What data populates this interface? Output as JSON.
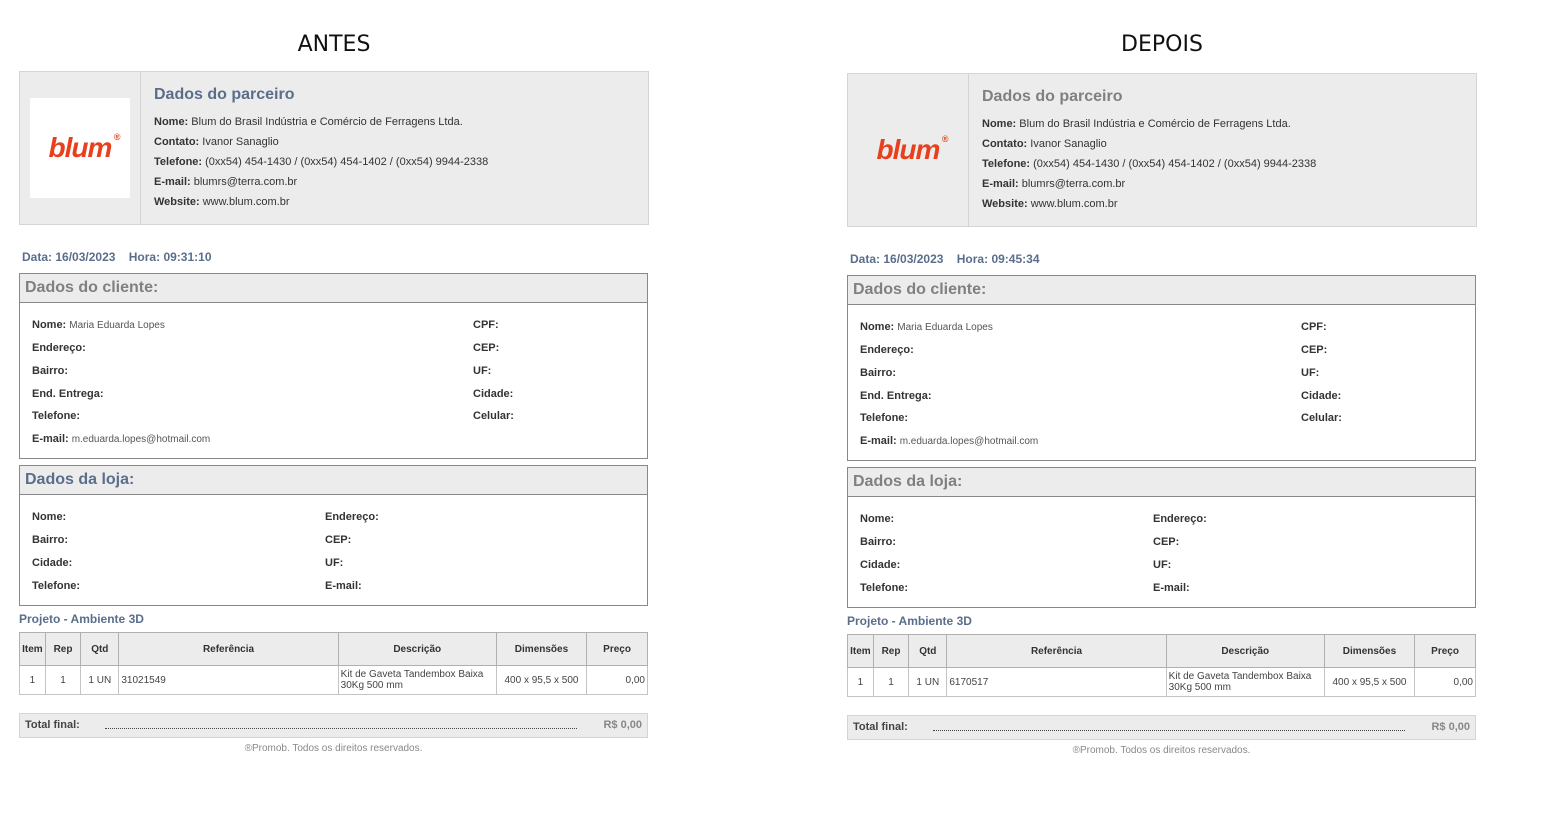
{
  "panels": [
    {
      "heading": "ANTES",
      "partner": {
        "title": "Dados do parceiro",
        "logo_text": "blum",
        "nome_label": "Nome:",
        "nome": "Blum do Brasil Indústria e Comércio de Ferragens Ltda.",
        "contato_label": "Contato:",
        "contato": "Ivanor Sanaglio",
        "telefone_label": "Telefone:",
        "telefone": "(0xx54) 454-1430 / (0xx54) 454-1402 / (0xx54) 9944-2338",
        "email_label": "E-mail:",
        "email": "blumrs@terra.com.br",
        "website_label": "Website:",
        "website": "www.blum.com.br"
      },
      "data_label": "Data:",
      "data": "16/03/2023",
      "hora_label": "Hora:",
      "hora": "09:31:10",
      "cliente": {
        "title": "Dados do cliente:",
        "nome_label": "Nome:",
        "nome": "Maria Eduarda Lopes",
        "cpf_label": "CPF:",
        "endereco_label": "Endereço:",
        "cep_label": "CEP:",
        "bairro_label": "Bairro:",
        "uf_label": "UF:",
        "entrega_label": "End. Entrega:",
        "cidade_label": "Cidade:",
        "telefone_label": "Telefone:",
        "celular_label": "Celular:",
        "email_label": "E-mail:",
        "email": "m.eduarda.lopes@hotmail.com"
      },
      "loja": {
        "title": "Dados da loja:",
        "nome_label": "Nome:",
        "endereco_label": "Endereço:",
        "bairro_label": "Bairro:",
        "cep_label": "CEP:",
        "cidade_label": "Cidade:",
        "uf_label": "UF:",
        "telefone_label": "Telefone:",
        "email_label": "E-mail:"
      },
      "projeto": "Projeto - Ambiente 3D",
      "table": {
        "headers": [
          "Item",
          "Rep",
          "Qtd",
          "Referência",
          "Descrição",
          "Dimensões",
          "Preço"
        ],
        "row": [
          "1",
          "1",
          "1 UN",
          "31021549",
          "Kit de Gaveta Tandembox Baixa 30Kg 500 mm",
          "400 x 95,5 x 500",
          "0,00"
        ]
      },
      "total_label": "Total final:",
      "total": "R$ 0,00",
      "footer": "®Promob. Todos os direitos reservados."
    },
    {
      "heading": "DEPOIS",
      "partner": {
        "title": "Dados do parceiro",
        "logo_text": "blum",
        "nome_label": "Nome:",
        "nome": "Blum do Brasil Indústria e Comércio de Ferragens Ltda.",
        "contato_label": "Contato:",
        "contato": "Ivanor Sanaglio",
        "telefone_label": "Telefone:",
        "telefone": "(0xx54) 454-1430 / (0xx54) 454-1402 / (0xx54) 9944-2338",
        "email_label": "E-mail:",
        "email": "blumrs@terra.com.br",
        "website_label": "Website:",
        "website": "www.blum.com.br"
      },
      "data_label": "Data:",
      "data": "16/03/2023",
      "hora_label": "Hora:",
      "hora": "09:45:34",
      "cliente": {
        "title": "Dados do cliente:",
        "nome_label": "Nome:",
        "nome": "Maria Eduarda Lopes",
        "cpf_label": "CPF:",
        "endereco_label": "Endereço:",
        "cep_label": "CEP:",
        "bairro_label": "Bairro:",
        "uf_label": "UF:",
        "entrega_label": "End. Entrega:",
        "cidade_label": "Cidade:",
        "telefone_label": "Telefone:",
        "celular_label": "Celular:",
        "email_label": "E-mail:",
        "email": "m.eduarda.lopes@hotmail.com"
      },
      "loja": {
        "title": "Dados da loja:",
        "nome_label": "Nome:",
        "endereco_label": "Endereço:",
        "bairro_label": "Bairro:",
        "cep_label": "CEP:",
        "cidade_label": "Cidade:",
        "uf_label": "UF:",
        "telefone_label": "Telefone:",
        "email_label": "E-mail:"
      },
      "projeto": "Projeto - Ambiente 3D",
      "table": {
        "headers": [
          "Item",
          "Rep",
          "Qtd",
          "Referência",
          "Descrição",
          "Dimensões",
          "Preço"
        ],
        "row": [
          "1",
          "1",
          "1 UN",
          "6170517",
          "Kit de Gaveta Tandembox Baixa 30Kg 500 mm",
          "400 x 95,5 x 500",
          "0,00"
        ]
      },
      "total_label": "Total final:",
      "total": "R$ 0,00",
      "footer": "®Promob. Todos os direitos reservados."
    }
  ]
}
